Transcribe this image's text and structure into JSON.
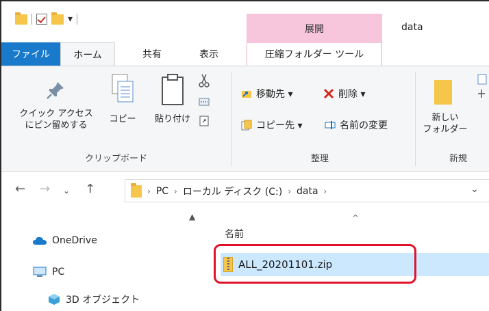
{
  "window": {
    "title": "data",
    "tools_context_label": "展開"
  },
  "tabs": [
    {
      "label": "ファイル"
    },
    {
      "label": "ホーム"
    },
    {
      "label": "共有"
    },
    {
      "label": "表示"
    },
    {
      "label": "圧縮フォルダー ツール"
    }
  ],
  "ribbon": {
    "clipboard": {
      "group_label": "クリップボード",
      "pin_label_line1": "クイック アクセス",
      "pin_label_line2": "にピン留めする",
      "copy_label": "コピー",
      "paste_label": "貼り付け"
    },
    "organize": {
      "group_label": "整理",
      "move_to": "移動先 ▾",
      "delete": "削除 ▾",
      "copy_to": "コピー先 ▾",
      "rename": "名前の変更"
    },
    "new": {
      "group_label": "新規",
      "new_folder_line1": "新しい",
      "new_folder_line2": "フォルダー"
    }
  },
  "address": {
    "crumbs": [
      "PC",
      "ローカル ディスク (C:)",
      "data"
    ]
  },
  "nav_pane": {
    "items": [
      {
        "label": "OneDrive"
      },
      {
        "label": "PC"
      },
      {
        "label": "3D オブジェクト"
      }
    ]
  },
  "content": {
    "column_name": "名前",
    "files": [
      {
        "name": "ALL_20201101.zip"
      }
    ]
  },
  "colors": {
    "accent": "#1979ca",
    "selection": "#cce8ff",
    "highlight": "#e2112a",
    "tools": "#f7c6dd"
  }
}
